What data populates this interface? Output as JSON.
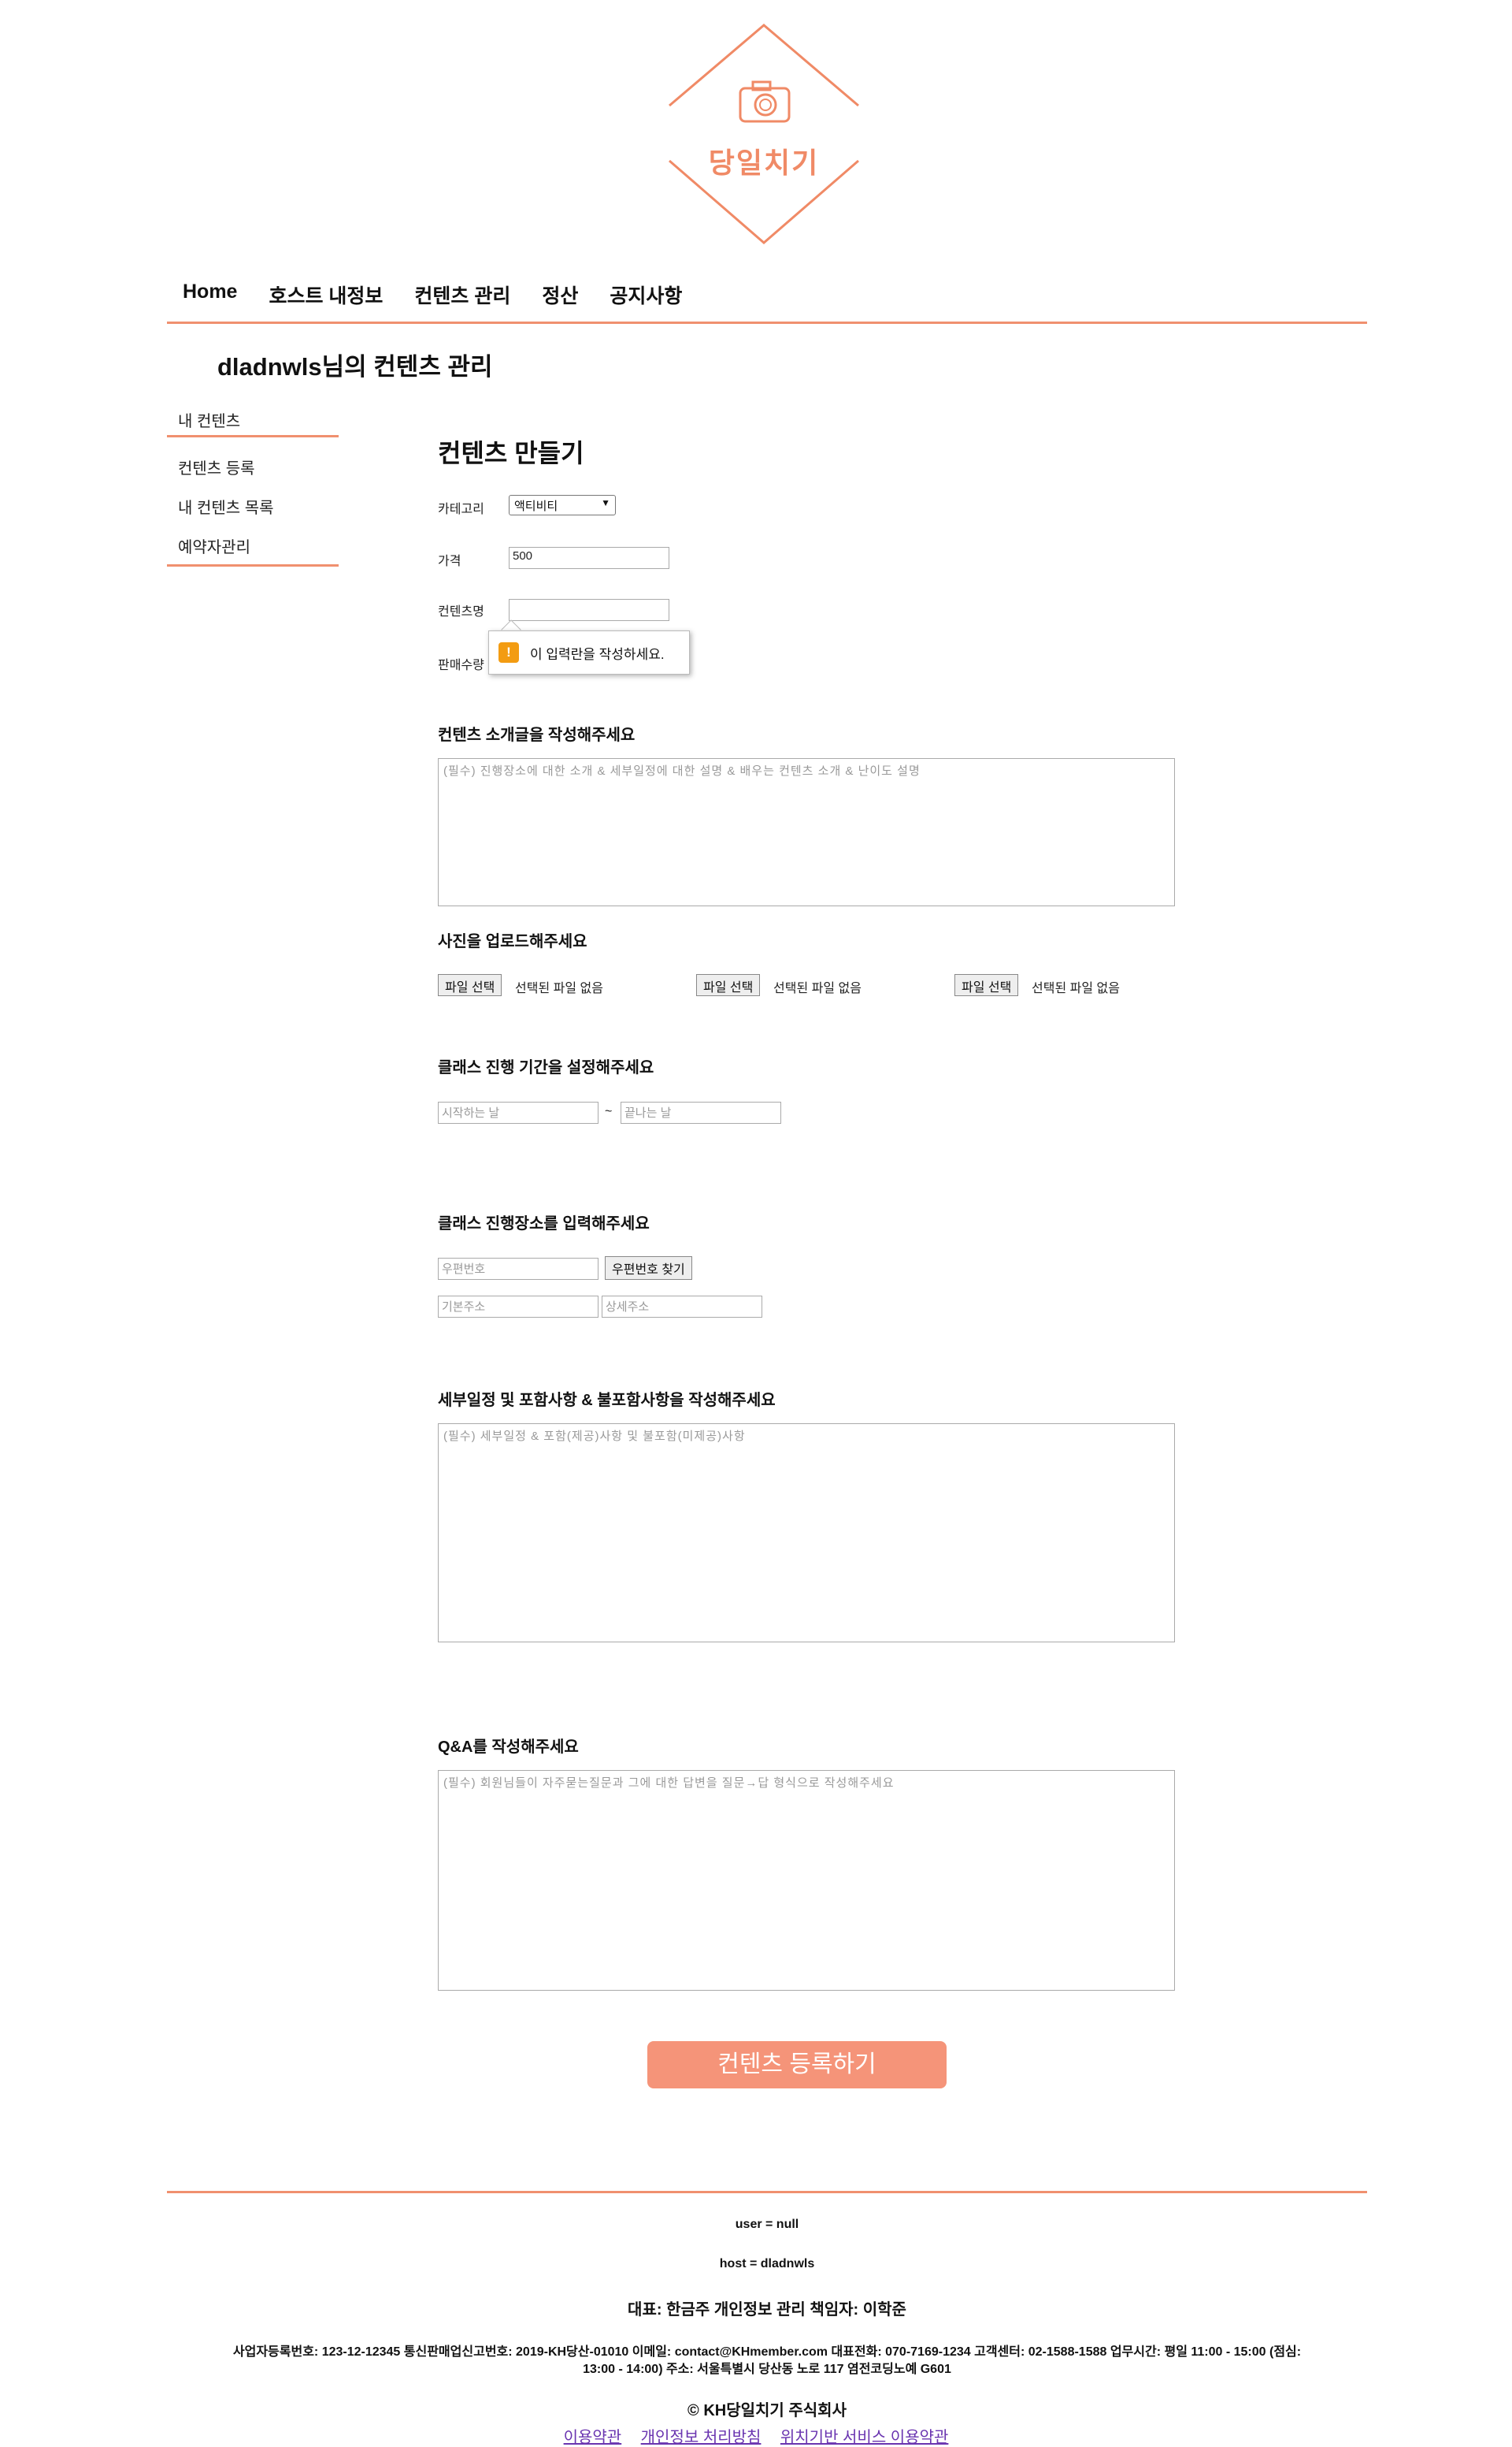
{
  "logo": {
    "text": "당일치기",
    "icon": "camera-icon",
    "color": "#f08a66"
  },
  "nav": {
    "items": [
      "Home",
      "호스트 내정보",
      "컨텐츠 관리",
      "정산",
      "공지사항"
    ]
  },
  "page_title": "dladnwls님의 컨텐츠 관리",
  "sidebar": {
    "items": [
      "내 컨텐츠",
      "컨텐츠 등록",
      "내 컨텐츠 목록",
      "예약자관리"
    ]
  },
  "form": {
    "title": "컨텐츠 만들기",
    "category_label": "카테고리",
    "category_value": "액티비티",
    "price_label": "가격",
    "price_value": "500",
    "name_label": "컨텐츠명",
    "qty_label": "판매수량",
    "tooltip": "이 입력란을 작성하세요.",
    "intro_title": "컨텐츠 소개글을 작성해주세요",
    "intro_placeholder": "(필수) 진행장소에 대한 소개 & 세부일정에 대한 설명 & 배우는 컨텐츠 소개 & 난이도 설명",
    "photo_title": "사진을 업로드해주세요",
    "file_button": "파일 선택",
    "file_status": "선택된 파일 없음",
    "period_title": "클래스 진행 기간을 설정해주세요",
    "start_placeholder": "시작하는 날",
    "tilde": "~",
    "end_placeholder": "끝나는 날",
    "place_title": "클래스 진행장소를 입력해주세요",
    "zip_placeholder": "우편번호",
    "zip_button": "우편번호 찾기",
    "addr1_placeholder": "기본주소",
    "addr2_placeholder": "상세주소",
    "detail_title": "세부일정 및 포함사항 & 불포함사항을 작성해주세요",
    "detail_placeholder": "(필수) 세부일정 & 포함(제공)사항 및 불포함(미제공)사항",
    "qa_title": "Q&A를 작성해주세요",
    "qa_placeholder": "(필수) 회원님들이 자주묻는질문과 그에 대한 답변을 질문→답 형식으로 작성해주세요",
    "submit": "컨텐츠 등록하기"
  },
  "footer": {
    "user": "user = null",
    "host": "host = dladnwls",
    "ceo": "대표: 한금주 개인정보 관리 책임자: 이학준",
    "info1": "사업자등록번호: 123-12-12345 통신판매업신고번호: 2019-KH당산-01010 이메일: contact@KHmember.com 대표전화: 070-7169-1234 고객센터: 02-1588-1588 업무시간: 평일 11:00 - 15:00 (점심:",
    "info2": "13:00 - 14:00) 주소: 서울특별시 당산동 노로 117 염전코딩노예 G601",
    "copyright": "© KH당일치기 주식회사",
    "links": [
      "이용약관",
      "개인정보 처리방침",
      "위치기반 서비스 이용약관"
    ]
  },
  "colors": {
    "accent": "#f0906f",
    "button": "#f59479"
  }
}
